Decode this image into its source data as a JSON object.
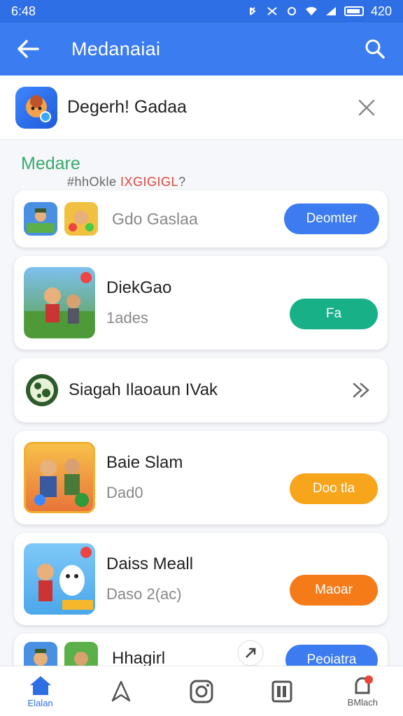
{
  "status_bar": {
    "time": "6:48",
    "battery": "420"
  },
  "app_bar": {
    "title": "Medanaiai",
    "back_icon": "arrow-left-icon",
    "search_icon": "search-icon"
  },
  "header": {
    "title": "Degerh! Gadaa",
    "close_icon": "close-icon"
  },
  "section": {
    "title": "Medare",
    "subtitle_prefix": "#hhOkle ",
    "subtitle_highlight": "IXGIGIGL",
    "subtitle_suffix": "?"
  },
  "cards": [
    {
      "title": "Gdo Gaslaa",
      "button": "Deomter",
      "button_color": "#3c7bf0"
    },
    {
      "title": "DiekGao",
      "subtitle": "1ades",
      "button": "Fa",
      "button_color": "#17b087"
    },
    {
      "title": "Siagah Ilaoaun IVak",
      "icon": "chevron-right-double-icon"
    },
    {
      "title": "Baie Slam",
      "subtitle": "Dad0",
      "button": "Doo tla",
      "button_color": "#f7a51b"
    },
    {
      "title": "Daiss Meall",
      "subtitle": "Daso 2(ac)",
      "button": "Maoar",
      "button_color": "#f57a18"
    },
    {
      "title": "Hhagirl",
      "button": "Peoiatra",
      "button_color": "#3c7bf0"
    }
  ],
  "bottom_nav": [
    {
      "label": "Elalan",
      "icon": "home-icon",
      "active": true
    },
    {
      "label": "",
      "icon": "navigation-icon",
      "active": false
    },
    {
      "label": "",
      "icon": "camera-icon",
      "active": false
    },
    {
      "label": "",
      "icon": "library-icon",
      "active": false
    },
    {
      "label": "BMlach",
      "icon": "notification-icon",
      "active": false
    }
  ]
}
